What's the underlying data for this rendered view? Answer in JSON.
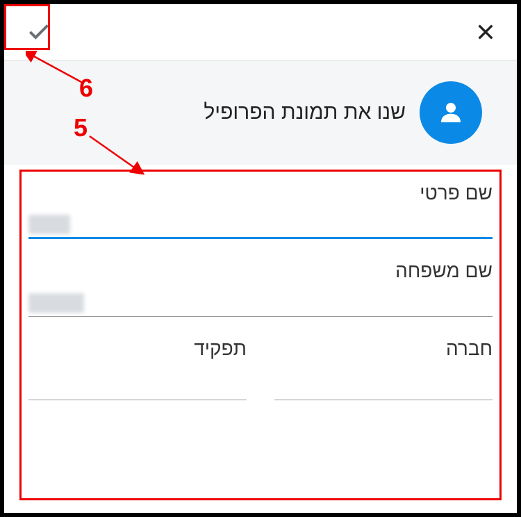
{
  "header": {
    "confirm_label": "confirm",
    "close_label": "close"
  },
  "avatar": {
    "change_text": "שנו את תמונת הפרופיל"
  },
  "form": {
    "first_name": {
      "label": "שם פרטי",
      "value": ""
    },
    "last_name": {
      "label": "שם משפחה",
      "value": ""
    },
    "company": {
      "label": "חברה",
      "value": ""
    },
    "role": {
      "label": "תפקיד",
      "value": ""
    }
  },
  "callouts": {
    "five": "5",
    "six": "6"
  }
}
